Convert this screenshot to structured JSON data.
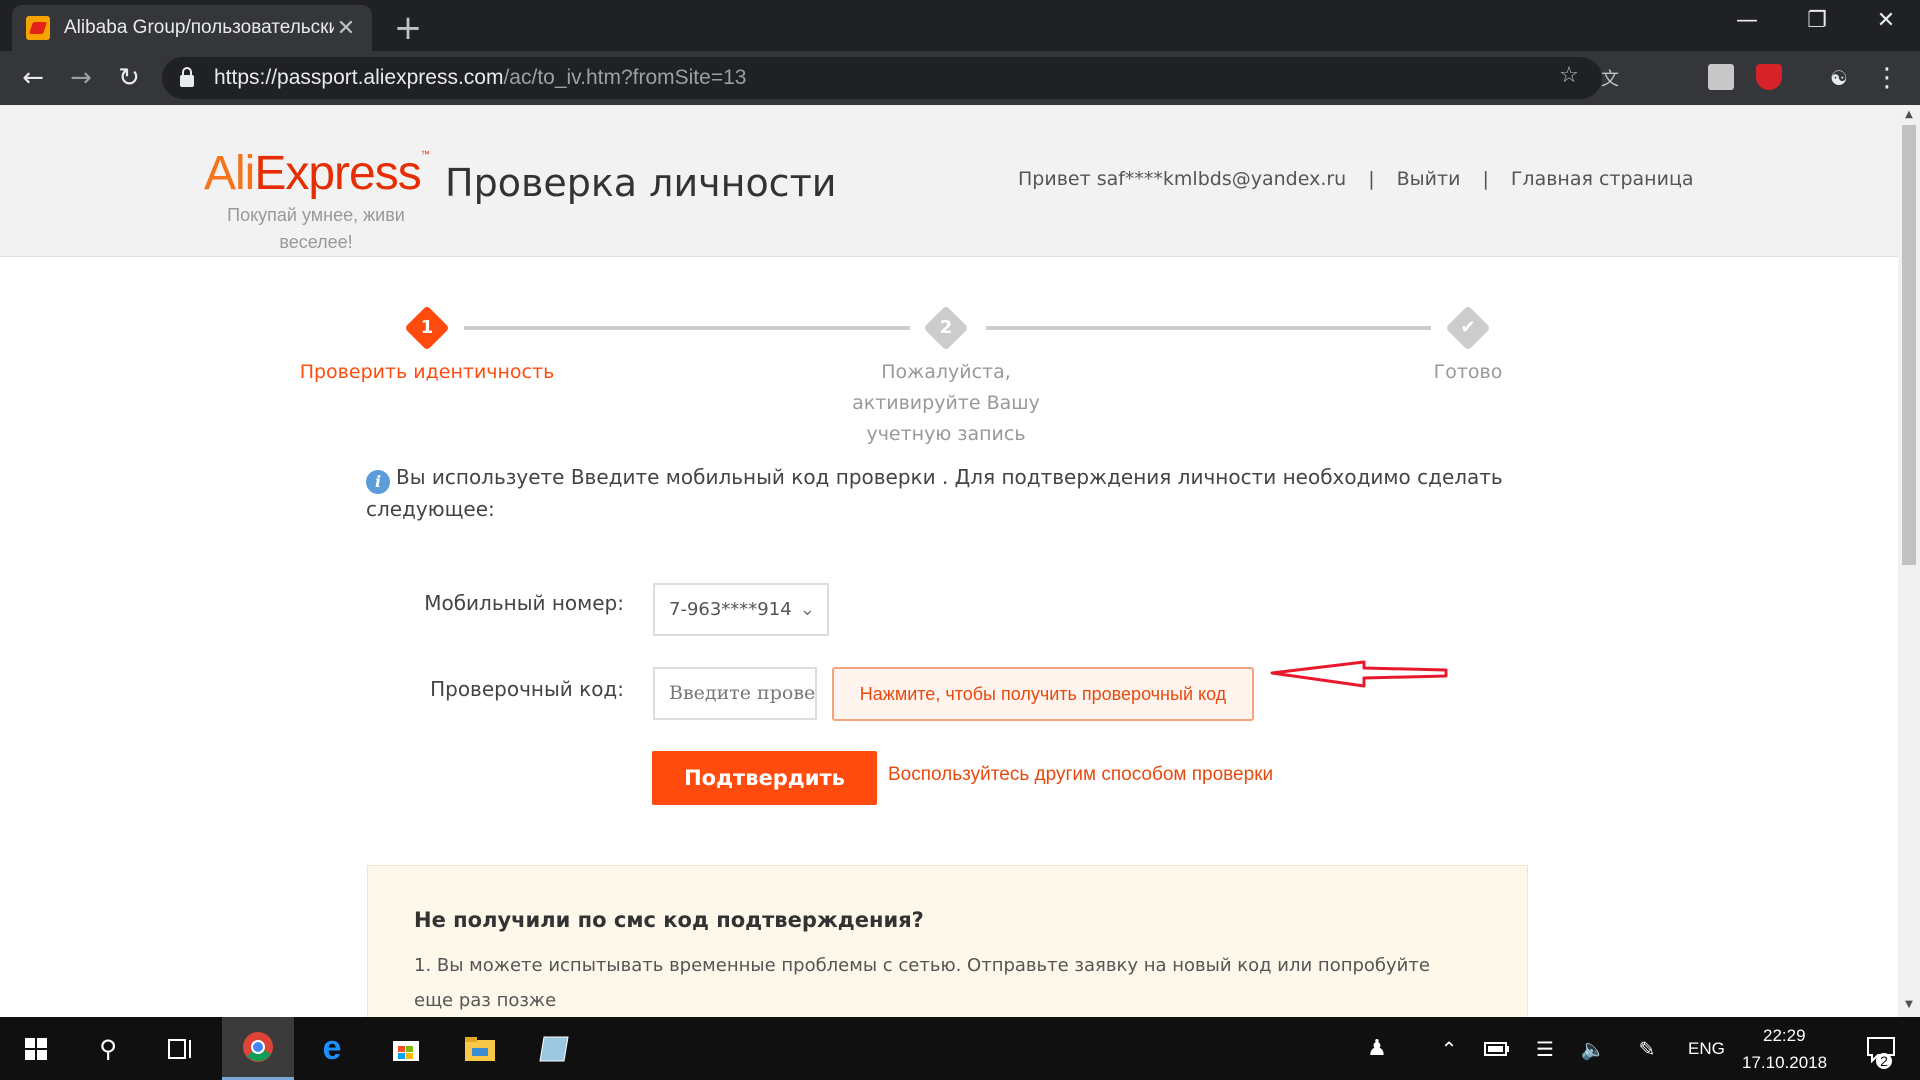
{
  "browser": {
    "tab_title": "Alibaba Group/пользовательский",
    "tab_close": "✕",
    "new_tab": "+",
    "window_controls": {
      "minimize": "—",
      "restore": "❐",
      "close": "✕"
    },
    "url_host": "https://passport.aliexpress.com",
    "url_path": "/ac/to_iv.htm?fromSite=13"
  },
  "header": {
    "logo_ali": "Ali",
    "logo_express": "Express",
    "logo_tm": "™",
    "slogan": "Покупай умнее, живи веселее!",
    "title": "Проверка личности",
    "greeting": "Привет saf****kmlbds@yandex.ru",
    "separator": "|",
    "logout": "Выйти",
    "home": "Главная страница"
  },
  "steps": [
    {
      "marker": "1",
      "label": "Проверить идентичность",
      "state": "active",
      "color": "#ff4c0e"
    },
    {
      "marker": "2",
      "label": "Пожалуйста, активируйте Вашу учетную запись",
      "state": "pending",
      "color": "#cccccc"
    },
    {
      "marker": "✔",
      "label": "Готово",
      "state": "pending",
      "color": "#cccccc"
    }
  ],
  "info": {
    "icon": "i",
    "text": "Вы используете Введите мобильный код проверки . Для подтверждения личности необходимо сделать следующее:"
  },
  "form": {
    "phone_label": "Мобильный номер:",
    "phone_value": "7-963****914",
    "code_label": "Проверочный код:",
    "code_placeholder": "Введите проверочный код",
    "get_code_button": "Нажмите, чтобы получить проверочный код",
    "confirm_button": "Подтвердить",
    "alt_method_link": "Воспользуйтесь другим способом проверки"
  },
  "sms_help": {
    "title": "Не получили по смс код подтверждения?",
    "text": "1. Вы можете испытывать временные проблемы с сетью. Отправьте заявку на новый код или попробуйте еще раз позже"
  },
  "taskbar": {
    "language": "ENG",
    "time": "22:29",
    "date": "17.10.2018",
    "notifications": "2"
  },
  "colors": {
    "accent": "#ff4c0e",
    "link": "#e84a0e",
    "annotation_arrow": "#e8192c"
  }
}
